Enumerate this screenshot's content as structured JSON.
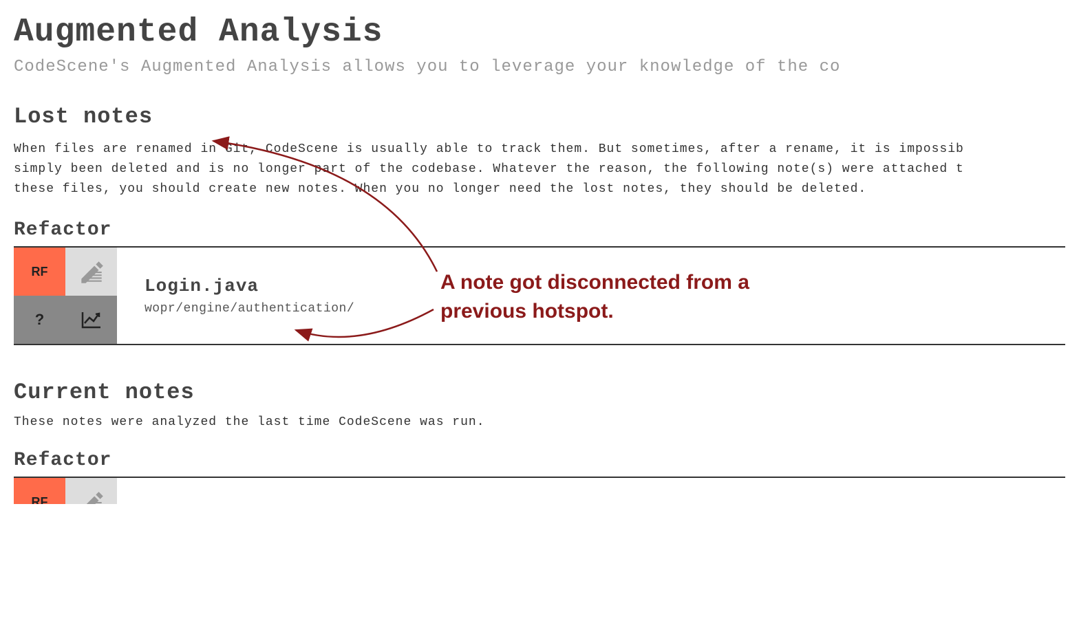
{
  "page": {
    "title": "Augmented Analysis",
    "subtitle": "CodeScene's Augmented Analysis allows you to leverage your knowledge of the co"
  },
  "lostNotes": {
    "heading": "Lost notes",
    "description_line1": "When files are renamed in Git, CodeScene is usually able to track them. But sometimes, after a rename, it is impossib",
    "description_line2": "simply been deleted and is no longer part of the codebase. Whatever the reason, the following note(s) were attached t",
    "description_line3": "these files, you should create new notes. When you no longer need the lost notes, they should be deleted.",
    "subheading": "Refactor",
    "note": {
      "rfLabel": "RF",
      "questionLabel": "?",
      "fileName": "Login.java",
      "filePath": "wopr/engine/authentication/"
    }
  },
  "currentNotes": {
    "heading": "Current notes",
    "description": "These notes were analyzed the last time CodeScene was run.",
    "subheading": "Refactor",
    "rfLabel": "RF"
  },
  "annotation": {
    "text_line1": "A note got disconnected from a",
    "text_line2": "previous hotspot."
  }
}
